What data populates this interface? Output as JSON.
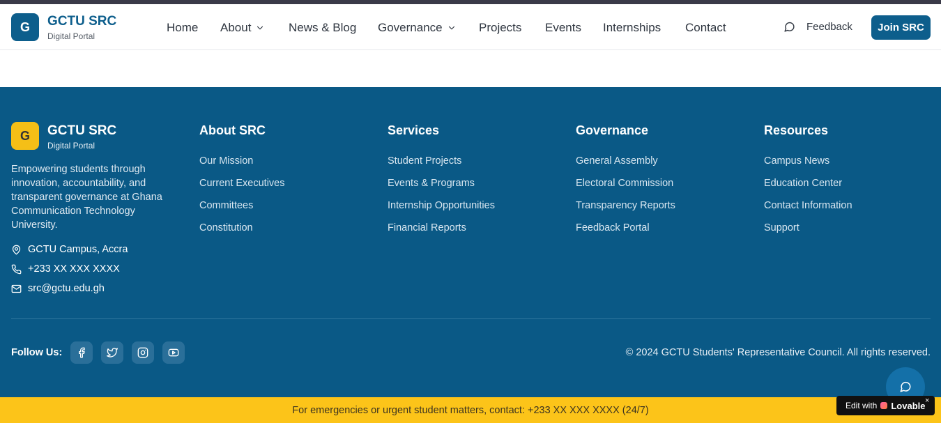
{
  "header": {
    "logo_letter": "G",
    "brand_title": "GCTU SRC",
    "brand_subtitle": "Digital Portal",
    "nav": [
      {
        "label": "Home",
        "has_dropdown": false
      },
      {
        "label": "About",
        "has_dropdown": true
      },
      {
        "label": "News & Blog",
        "has_dropdown": false
      },
      {
        "label": "Governance",
        "has_dropdown": true
      },
      {
        "label": "Projects",
        "has_dropdown": false
      },
      {
        "label": "Events",
        "has_dropdown": false
      },
      {
        "label": "Internships",
        "has_dropdown": false
      },
      {
        "label": "Contact",
        "has_dropdown": false
      }
    ],
    "feedback_label": "Feedback",
    "join_label": "Join SRC"
  },
  "footer": {
    "logo_letter": "G",
    "brand_title": "GCTU SRC",
    "brand_subtitle": "Digital Portal",
    "description": "Empowering students through innovation, accountability, and transparent governance at Ghana Communication Technology University.",
    "contact": {
      "location": "GCTU Campus, Accra",
      "phone": "+233 XX XXX XXXX",
      "email": "src@gctu.edu.gh"
    },
    "columns": [
      {
        "title": "About SRC",
        "links": [
          "Our Mission",
          "Current Executives",
          "Committees",
          "Constitution"
        ]
      },
      {
        "title": "Services",
        "links": [
          "Student Projects",
          "Events & Programs",
          "Internship Opportunities",
          "Financial Reports"
        ]
      },
      {
        "title": "Governance",
        "links": [
          "General Assembly",
          "Electoral Commission",
          "Transparency Reports",
          "Feedback Portal"
        ]
      },
      {
        "title": "Resources",
        "links": [
          "Campus News",
          "Education Center",
          "Contact Information",
          "Support"
        ]
      }
    ],
    "follow_label": "Follow Us:",
    "social_icons": [
      "facebook-icon",
      "twitter-icon",
      "instagram-icon",
      "youtube-icon"
    ],
    "copyright": "© 2024 GCTU Students' Representative Council. All rights reserved."
  },
  "emergency": {
    "text": "For emergencies or urgent student matters, contact: +233 XX XXX XXXX (24/7)"
  },
  "badge": {
    "prefix": "Edit with",
    "brand": "Lovable",
    "close": "×"
  },
  "colors": {
    "primary": "#0d5e8c",
    "footer_bg": "#0a5986",
    "accent_yellow": "#fcc419",
    "logo_yellow": "#f5bf17"
  }
}
